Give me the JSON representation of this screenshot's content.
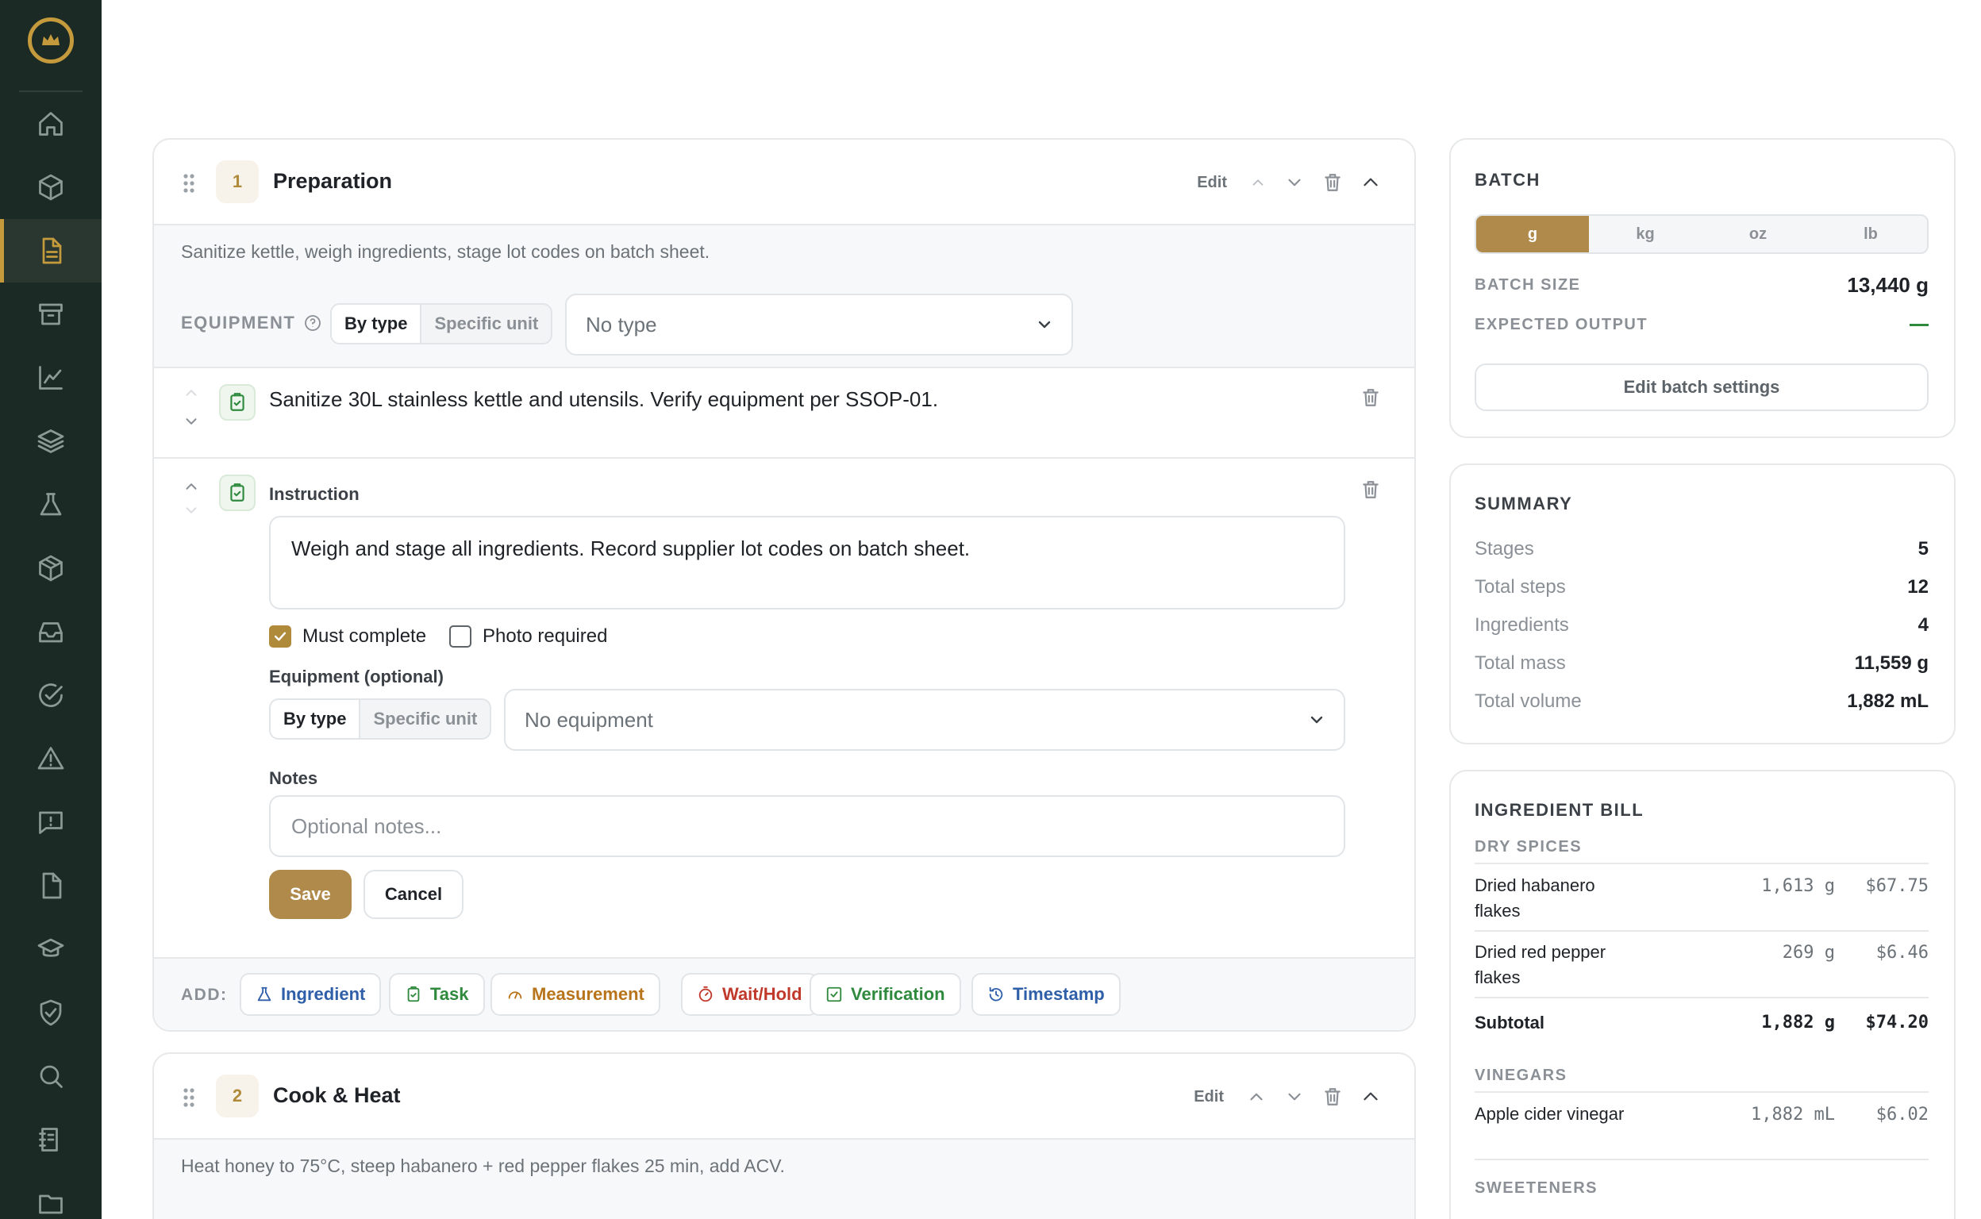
{
  "sidebar": {
    "items": [
      "home",
      "box",
      "document",
      "archive",
      "chart",
      "layers",
      "flask",
      "package",
      "inbox",
      "check-circle",
      "warning",
      "feedback",
      "file",
      "graduation",
      "shield",
      "search",
      "ledger",
      "folder"
    ]
  },
  "stages": [
    {
      "number": "1",
      "title": "Preparation",
      "edit_label": "Edit",
      "description": "Sanitize kettle, weigh ingredients, stage lot codes on batch sheet.",
      "equipment_label": "EQUIPMENT",
      "mode_by_type": "By type",
      "mode_specific": "Specific unit",
      "equipment_select": "No type",
      "steps": [
        {
          "text": "Sanitize 30L stainless kettle and utensils. Verify equipment per SSOP-01."
        }
      ],
      "editor": {
        "type_label": "Instruction",
        "instruction": "Weigh and stage all ingredients. Record supplier lot codes on batch sheet.",
        "must_complete": "Must complete",
        "photo_required": "Photo required",
        "equipment_optional": "Equipment (optional)",
        "mode_by_type": "By type",
        "mode_specific": "Specific unit",
        "equipment_select": "No equipment",
        "notes_label": "Notes",
        "notes_placeholder": "Optional notes...",
        "save": "Save",
        "cancel": "Cancel"
      },
      "add": {
        "label": "ADD:",
        "chips": [
          "Ingredient",
          "Task",
          "Measurement",
          "Wait/Hold",
          "Verification",
          "Timestamp"
        ]
      }
    },
    {
      "number": "2",
      "title": "Cook & Heat",
      "edit_label": "Edit",
      "description": "Heat honey to 75°C, steep habanero + red pepper flakes 25 min, add ACV."
    }
  ],
  "colors": {
    "accent": "#b08a4a",
    "sidebar": "#1c2a25",
    "green": "#2f8a3e",
    "blue": "#2f5fa8",
    "orange": "#b8741a",
    "red": "#c0392b"
  },
  "batch": {
    "title": "BATCH",
    "units": [
      "g",
      "kg",
      "oz",
      "lb"
    ],
    "selected_unit": "g",
    "batch_size_label": "BATCH SIZE",
    "batch_size": "13,440 g",
    "expected_output_label": "EXPECTED OUTPUT",
    "edit_button": "Edit batch settings"
  },
  "summary": {
    "title": "SUMMARY",
    "rows": [
      {
        "label": "Stages",
        "value": "5"
      },
      {
        "label": "Total steps",
        "value": "12"
      },
      {
        "label": "Ingredients",
        "value": "4"
      },
      {
        "label": "Total mass",
        "value": "11,559 g"
      },
      {
        "label": "Total volume",
        "value": "1,882 mL"
      }
    ]
  },
  "ingredient_bill": {
    "title": "INGREDIENT BILL",
    "dry_spices": "DRY SPICES",
    "items": [
      {
        "name": "Dried habanero flakes",
        "qty": "1,613 g",
        "cost": "$67.75"
      },
      {
        "name": "Dried red pepper flakes",
        "qty": "269 g",
        "cost": "$6.46"
      }
    ],
    "subtotal_label": "Subtotal",
    "subtotal_qty": "1,882 g",
    "subtotal_cost": "$74.20",
    "vinegars": "VINEGARS",
    "vinegar_items": [
      {
        "name": "Apple cider vinegar",
        "qty": "1,882 mL",
        "cost": "$6.02"
      }
    ],
    "sweeteners": "SWEETENERS"
  }
}
